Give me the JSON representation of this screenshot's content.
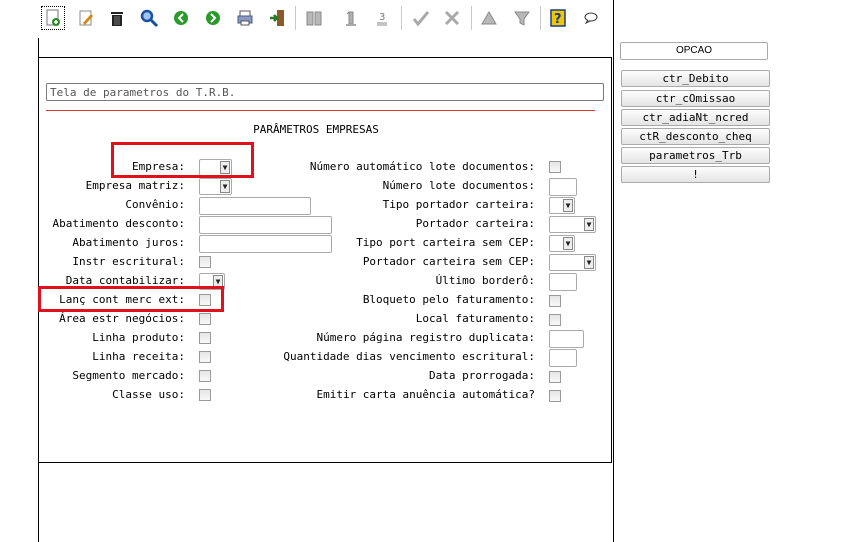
{
  "toolbar": {
    "buttons": [
      {
        "name": "new-icon",
        "color": "#2a8a2a"
      },
      {
        "name": "edit-icon",
        "color": "#d08a10"
      },
      {
        "name": "delete-icon",
        "color": "#222222"
      },
      {
        "name": "search-icon",
        "color": "#1a4fa0"
      },
      {
        "name": "back-icon",
        "color": "#2a9a2a"
      },
      {
        "name": "forward-icon",
        "color": "#2a9a2a"
      },
      {
        "name": "print-icon",
        "color": "#4a5a8a"
      },
      {
        "name": "exit-icon",
        "color": "#2a7a2a"
      },
      {
        "name": "book-icon",
        "color": "#aaaaaa"
      },
      {
        "name": "first-icon",
        "color": "#aaaaaa"
      },
      {
        "name": "list-icon",
        "color": "#aaaaaa"
      },
      {
        "name": "check-icon",
        "color": "#aaaaaa"
      },
      {
        "name": "tools-icon",
        "color": "#aaaaaa"
      },
      {
        "name": "triangle-up-icon",
        "color": "#aaaaaa"
      },
      {
        "name": "filter-icon",
        "color": "#aaaaaa"
      },
      {
        "name": "help-icon",
        "color": "#d4a800"
      },
      {
        "name": "chat-icon",
        "color": "#333333"
      }
    ]
  },
  "form": {
    "title_value": "Tela de parametros do T.R.B.",
    "section_title": "PARÂMETROS EMPRESAS",
    "left_labels": {
      "empresa": "Empresa:",
      "empresa_matriz": "Empresa matriz:",
      "convenio": "Convênio:",
      "abatimento_desconto": "Abatimento desconto:",
      "abatimento_juros": "Abatimento juros:",
      "instr_escritural": "Instr escritural:",
      "data_contabilizar": "Data contabilizar:",
      "lanc_cont_merc_ext": "Lanç cont merc ext:",
      "area_estr_negocios": "Área estr negócios:",
      "linha_produto": "Linha produto:",
      "linha_receita": "Linha receita:",
      "segmento_mercado": "Segmento mercado:",
      "classe_uso": "Classe uso:"
    },
    "right_labels": {
      "numero_automatico_lote": "Número automático lote documentos:",
      "numero_lote": "Número lote documentos:",
      "tipo_portador_carteira": "Tipo portador carteira:",
      "portador_carteira": "Portador carteira:",
      "tipo_port_carteira_sem_cep": "Tipo port carteira sem CEP:",
      "portador_carteira_sem_cep": "Portador carteira sem CEP:",
      "ultimo_bordero": "Último borderô:",
      "bloqueto_faturamento": "Bloqueto pelo faturamento:",
      "local_faturamento": "Local faturamento:",
      "numero_pagina_registro": "Número página registro duplicata:",
      "quantidade_dias_vencimento": "Quantidade dias vencimento escritural:",
      "data_prorrogada": "Data prorrogada:",
      "emitir_carta_anuencia": "Emitir carta anuência automática?"
    },
    "highlight_color": "#e0101c"
  },
  "options": {
    "header": "OPCAO",
    "buttons": [
      "ctr_Debito",
      "ctr_cOmissao",
      "ctr_adiaNt_ncred",
      "ctR_desconto_cheq",
      "parametros_Trb",
      "!"
    ]
  }
}
